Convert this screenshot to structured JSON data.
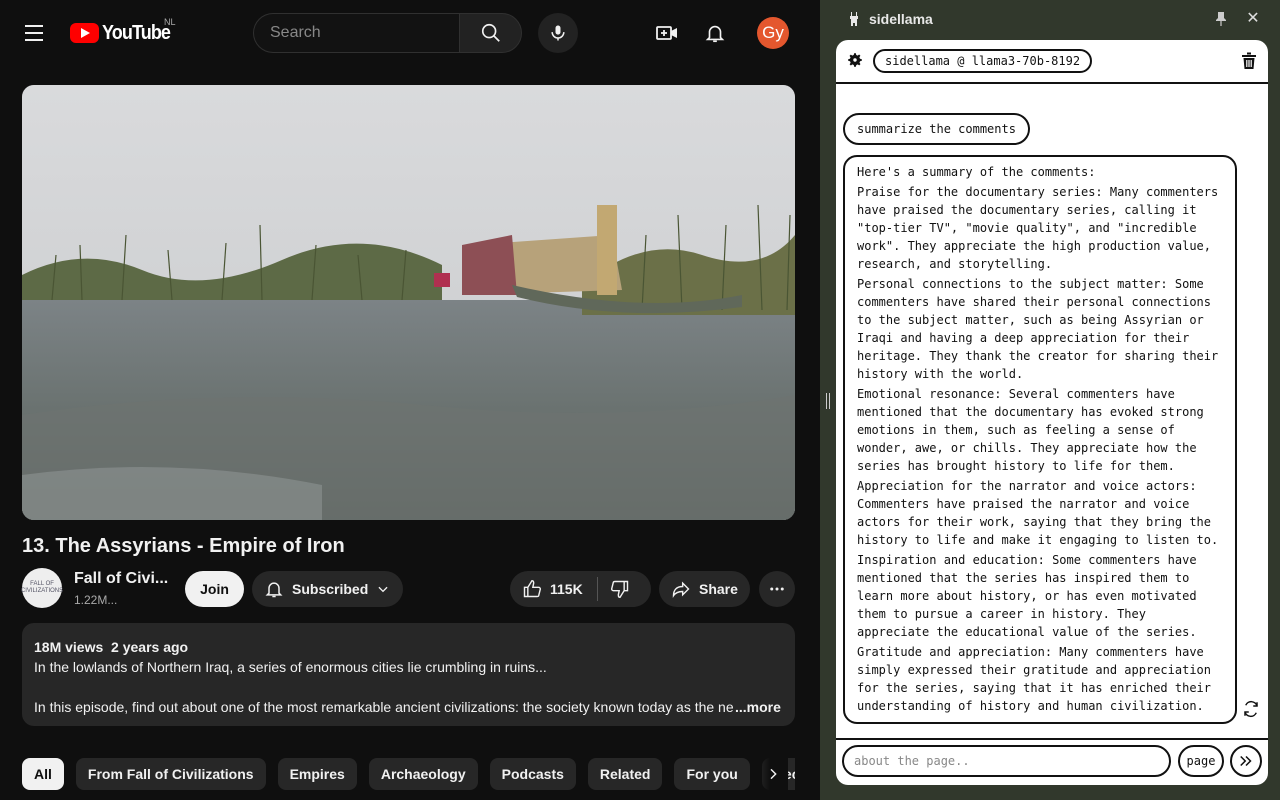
{
  "youtube": {
    "logo_text": "YouTube",
    "country_code": "NL",
    "search_placeholder": "Search",
    "avatar_initials": "Gy",
    "video": {
      "title": "13. The Assyrians - Empire of Iron",
      "channel_name": "Fall of Civi...",
      "channel_subs": "1.22M...",
      "channel_avatar_text": "FALL OF CIVILIZATIONS",
      "join_label": "Join",
      "subscribed_label": "Subscribed",
      "likes": "115K",
      "share_label": "Share"
    },
    "description": {
      "views": "18M views",
      "age": "2 years ago",
      "line1": "In the lowlands of Northern Iraq, a series of enormous cities lie crumbling in ruins...",
      "line2": "In this episode, find out about one of the most remarkable ancient civilizations: the society known today as the ne",
      "more_label": "...more"
    },
    "chips": [
      "All",
      "From Fall of Civilizations",
      "Empires",
      "Archaeology",
      "Podcasts",
      "Related",
      "For you",
      "Recently uploaded"
    ]
  },
  "sidellama": {
    "title": "sidellama",
    "model": "sidellama @ llama3-70b-8192",
    "user_message": "summarize the comments",
    "response": {
      "intro": "Here's a summary of the comments:",
      "paragraphs": [
        "Praise for the documentary series: Many commenters have praised the documentary series, calling it \"top-tier TV\", \"movie quality\", and \"incredible work\". They appreciate the high production value, research, and storytelling.",
        "Personal connections to the subject matter: Some commenters have shared their personal connections to the subject matter, such as being Assyrian or Iraqi and having a deep appreciation for their heritage. They thank the creator for sharing their history with the world.",
        "Emotional resonance: Several commenters have mentioned that the documentary has evoked strong emotions in them, such as feeling a sense of wonder, awe, or chills. They appreciate how the series has brought history to life for them.",
        "Appreciation for the narrator and voice actors: Commenters have praised the narrator and voice actors for their work, saying that they bring the history to life and make it engaging to listen to.",
        "Inspiration and education: Some commenters have mentioned that the series has inspired them to learn more about history, or has even motivated them to pursue a career in history. They appreciate the educational value of the series.",
        "Gratitude and appreciation: Many commenters have simply expressed their gratitude and appreciation for the series, saying that it has enriched their understanding of history and human civilization."
      ]
    },
    "input_placeholder": "about the page..",
    "page_button": "page"
  },
  "colors": {
    "yt_bg": "#0f0f0f",
    "yt_surface": "#272727",
    "yt_red": "#ff0000",
    "avatar_orange": "#e4572e",
    "sidebar_bg": "#31382c"
  }
}
